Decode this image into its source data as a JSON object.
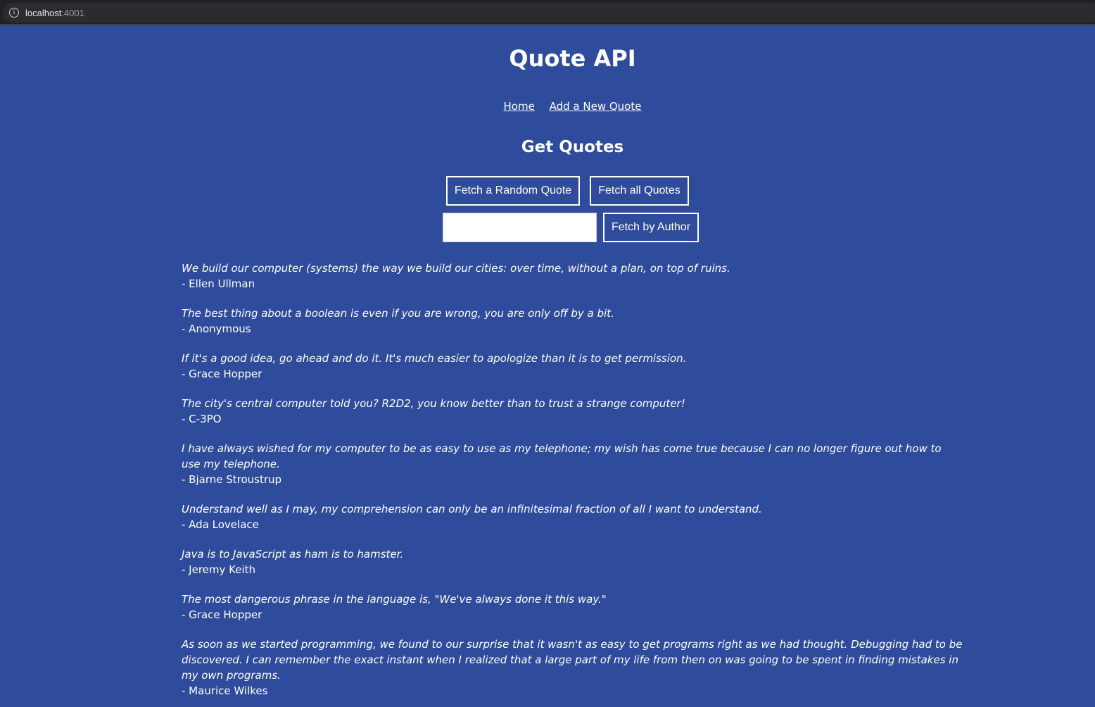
{
  "browser": {
    "url_host": "localhost",
    "url_port": ":4001"
  },
  "header": {
    "title": "Quote API",
    "nav": {
      "home": "Home",
      "add": "Add a New Quote"
    }
  },
  "main": {
    "heading": "Get Quotes",
    "buttons": {
      "random": "Fetch a Random Quote",
      "all": "Fetch all Quotes",
      "by_author": "Fetch by Author"
    },
    "author_input": {
      "value": "",
      "placeholder": ""
    },
    "quotes": [
      {
        "text": "We build our computer (systems) the way we build our cities: over time, without a plan, on top of ruins.",
        "author": "- Ellen Ullman"
      },
      {
        "text": "The best thing about a boolean is even if you are wrong, you are only off by a bit.",
        "author": "- Anonymous"
      },
      {
        "text": "If it's a good idea, go ahead and do it. It's much easier to apologize than it is to get permission.",
        "author": "- Grace Hopper"
      },
      {
        "text": "The city's central computer told you? R2D2, you know better than to trust a strange computer!",
        "author": "- C-3PO"
      },
      {
        "text": "I have always wished for my computer to be as easy to use as my telephone; my wish has come true because I can no longer figure out how to use my telephone.",
        "author": "- Bjarne Stroustrup"
      },
      {
        "text": "Understand well as I may, my comprehension can only be an infinitesimal fraction of all I want to understand.",
        "author": "- Ada Lovelace"
      },
      {
        "text": "Java is to JavaScript as ham is to hamster.",
        "author": "- Jeremy Keith"
      },
      {
        "text": "The most dangerous phrase in the language is, \"We've always done it this way.\"",
        "author": "- Grace Hopper"
      },
      {
        "text": "As soon as we started programming, we found to our surprise that it wasn't as easy to get programs right as we had thought. Debugging had to be discovered. I can remember the exact instant when I realized that a large part of my life from then on was going to be spent in finding mistakes in my own programs.",
        "author": "- Maurice Wilkes"
      }
    ]
  }
}
